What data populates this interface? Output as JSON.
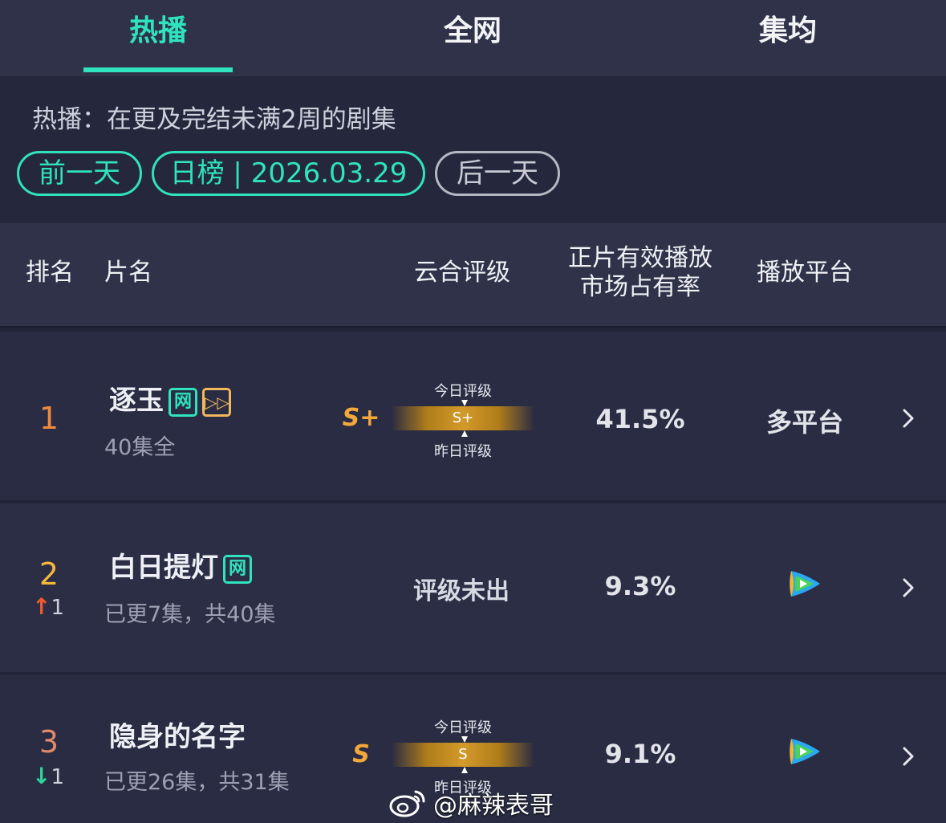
{
  "tabs": [
    {
      "label": "热播",
      "active": true
    },
    {
      "label": "全网",
      "active": false
    },
    {
      "label": "集均",
      "active": false
    }
  ],
  "info": {
    "description": "热播：在更及完结未满2周的剧集",
    "prev_day": "前一天",
    "date_label": "日榜 | 2026.03.29",
    "next_day": "后一天"
  },
  "table_header": {
    "rank": "排名",
    "title": "片名",
    "rating": "云合评级",
    "share_line1": "正片有效播放",
    "share_line2": "市场占有率",
    "platform": "播放平台"
  },
  "rows": [
    {
      "rank": "1",
      "title": "逐玉",
      "badges": [
        "网",
        "▷▷"
      ],
      "episodes": "40集全",
      "grade": "S+",
      "grade_bar_label": "S+",
      "grade_today_label": "今日评级",
      "grade_yesterday_label": "昨日评级",
      "share": "41.5%",
      "platform": "多平台"
    },
    {
      "rank": "2",
      "change_dir": "up",
      "change": "1",
      "title": "白日提灯",
      "badges": [
        "网"
      ],
      "episodes": "已更7集，共40集",
      "grade_pending": "评级未出",
      "share": "9.3%",
      "platform_icon": "tencent-video-icon"
    },
    {
      "rank": "3",
      "change_dir": "down",
      "change": "1",
      "title": "隐身的名字",
      "episodes": "已更26集，共31集",
      "grade": "S",
      "grade_bar_label": "S",
      "grade_today_label": "今日评级",
      "grade_yesterday_label": "昨日评级",
      "share": "9.1%",
      "platform_icon": "tencent-video-icon"
    }
  ],
  "watermark": "@麻辣表哥",
  "colors": {
    "accent": "#2fe3bf",
    "background": "#22243a",
    "header_bg": "#2f3249",
    "grade_gold": "#f2a83a",
    "up": "#ef5a2f",
    "down": "#2fd39b"
  }
}
